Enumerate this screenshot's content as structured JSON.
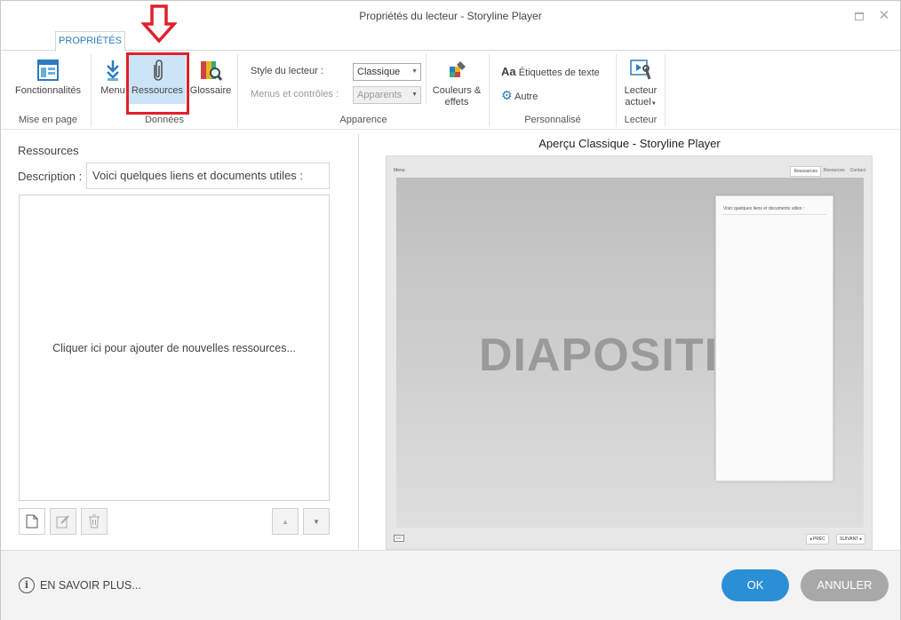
{
  "window": {
    "title": "Propriétés du lecteur - Storyline Player"
  },
  "ribbon": {
    "tab": "PROPRIÉTÉS",
    "groups": {
      "layout": {
        "label": "Mise en page",
        "features": "Fonctionnalités"
      },
      "data": {
        "label": "Données",
        "menu": "Menu",
        "resources": "Ressources",
        "glossary": "Glossaire"
      },
      "appearance": {
        "label": "Apparence",
        "player_style_label": "Style du lecteur :",
        "player_style_value": "Classique",
        "menus_controls_label": "Menus et contrôles :",
        "menus_controls_value": "Apparents",
        "colors_line1": "Couleurs &",
        "colors_line2": "effets"
      },
      "custom": {
        "label": "Personnalisé",
        "text_labels": "Étiquettes de texte",
        "other": "Autre"
      },
      "player": {
        "label": "Lecteur",
        "current_line1": "Lecteur",
        "current_line2": "actuel"
      }
    }
  },
  "resources_pane": {
    "title": "Ressources",
    "description_label": "Description :",
    "description_value": "Voici quelques liens et documents utiles :",
    "empty_prompt": "Cliquer ici pour ajouter de nouvelles ressources..."
  },
  "preview": {
    "title": "Aperçu Classique - Storyline Player",
    "menu_label": "Menu",
    "tabs": [
      "Ressources",
      "Resources",
      "Contact"
    ],
    "slide_text": "DIAPOSITI",
    "popup_text": "Voici quelques liens et documents utiles :",
    "cc_label": "CC",
    "prev": "PRÉC",
    "next": "SUIVANT"
  },
  "footer": {
    "learn_more": "EN SAVOIR PLUS...",
    "ok": "OK",
    "cancel": "ANNULER"
  },
  "colors": {
    "accent": "#2b8fd6",
    "highlight_box": "#e0202a",
    "selected_bg": "#cce4f7"
  }
}
